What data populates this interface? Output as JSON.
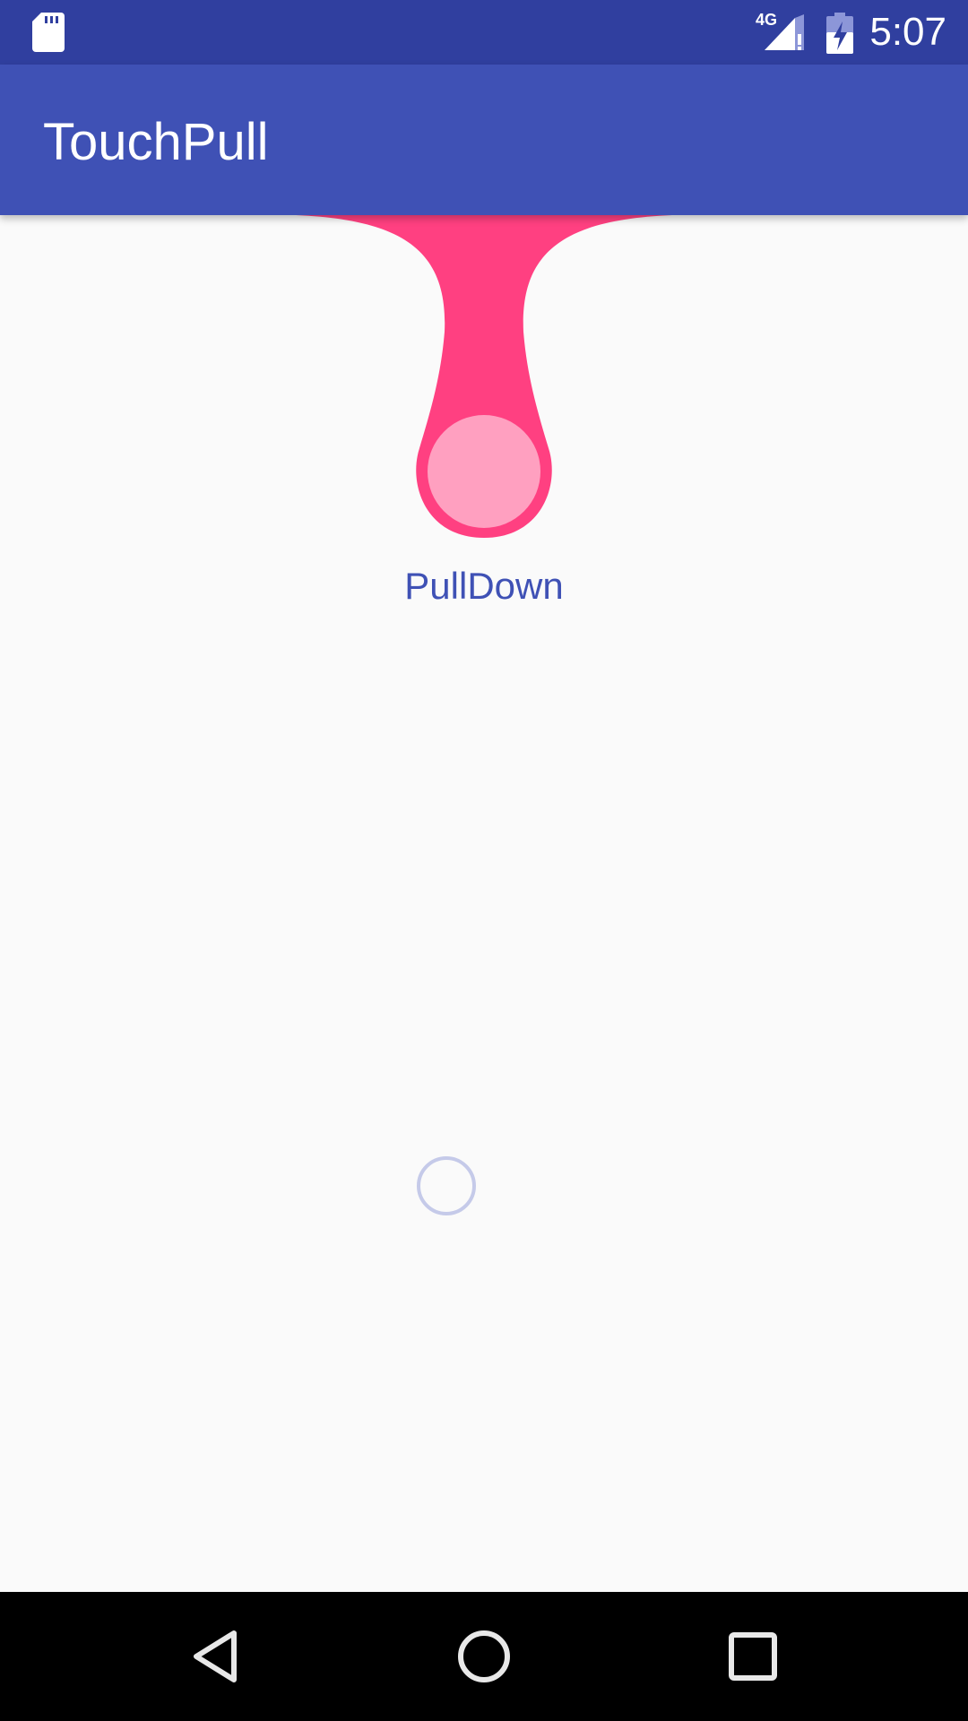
{
  "status_bar": {
    "network_type": "4G",
    "time": "5:07",
    "icons": [
      "sd-card-icon",
      "signal-icon",
      "battery-charging-icon"
    ]
  },
  "app_bar": {
    "title": "TouchPull"
  },
  "pull_view": {
    "label": "PullDown"
  },
  "colors": {
    "status_bar": "#303f9f",
    "app_bar": "#3f51b5",
    "accent_pink": "#ff4081",
    "ball_light_pink": "#ffa0c0",
    "label_blue": "#3f51b5",
    "background": "#fafafa"
  },
  "nav_bar": {
    "buttons": [
      "back-icon",
      "home-icon",
      "recents-icon"
    ]
  }
}
